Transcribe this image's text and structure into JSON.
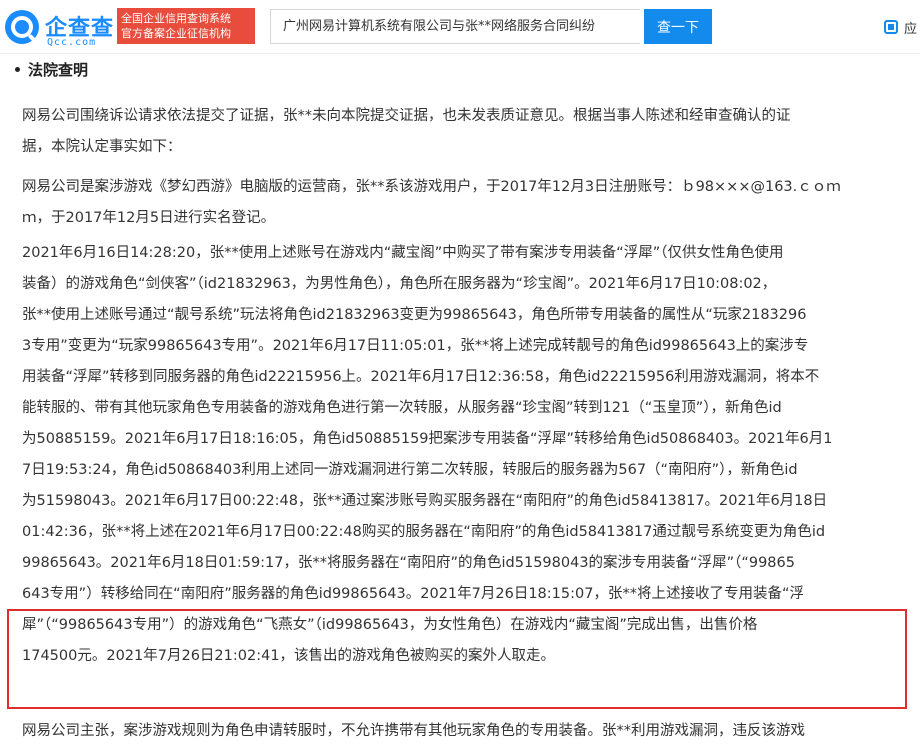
{
  "header": {
    "logo_name": "企查查",
    "logo_url": "Qcc.com",
    "slogan_line1": "全国企业信用查询系统",
    "slogan_line2": "官方备案企业征信机构",
    "search_value": "广州网易计算机系统有限公司与张**网络服务合同纠纷",
    "search_button": "查一下",
    "app_label": "应"
  },
  "section": {
    "title": "法院查明"
  },
  "paragraphs": [
    {
      "lines": [
        "网易公司围绕诉讼请求依法提交了证据，张**未向本院提交证据，也未发表质证意见。根据当事人陈述和经审查确认的证",
        "据，本院认定事实如下："
      ]
    },
    {
      "lines": [
        "网易公司是案涉游戏《梦幻西游》电脑版的运营商，张**系该游戏用户，于2017年12月3日注册账号：ｂ98×××@163.ｃｏｍ",
        "ｍ，于2017年12月5日进行实名登记。"
      ]
    },
    {
      "lines": [
        "2021年6月16日14:28:20，张**使用上述账号在游戏内“藏宝阁”中购买了带有案涉专用装备“浮犀”（仅供女性角色使用",
        "装备）的游戏角色“剑侠客”（id21832963，为男性角色），角色所在服务器为“珍宝阁”。2021年6月17日10:08:02，",
        "张**使用上述账号通过“靓号系统”玩法将角色id21832963变更为99865643，角色所带专用装备的属性从“玩家2183296",
        "3专用”变更为“玩家99865643专用”。2021年6月17日11:05:01，张**将上述完成转靓号的角色id99865643上的案涉专",
        "用装备“浮犀”转移到同服务器的角色id22215956上。2021年6月17日12:36:58，角色id22215956利用游戏漏洞，将本不",
        "能转服的、带有其他玩家角色专用装备的游戏角色进行第一次转服，从服务器“珍宝阁”转到121（“玉皇顶”），新角色id",
        "为50885159。2021年6月17日18:16:05，角色id50885159把案涉专用装备“浮犀”转移给角色id50868403。2021年6月1",
        "7日19:53:24，角色id50868403利用上述同一游戏漏洞进行第二次转服，转服后的服务器为567（“南阳府”），新角色id",
        "为51598043。2021年6月17日00:22:48，张**通过案涉账号购买服务器在“南阳府”的角色id58413817。2021年6月18日",
        "01:42:36，张**将上述在2021年6月17日00:22:48购买的服务器在“南阳府”的角色id58413817通过靓号系统变更为角色id",
        "99865643。2021年6月18日01:59:17，张**将服务器在“南阳府”的角色id51598043的案涉专用装备“浮犀”（“99865",
        "643专用”）转移给同在“南阳府”服务器的角色id99865643。2021年7月26日18:15:07，张**将上述接收了专用装备“浮",
        "犀”（“99865643专用”）的游戏角色“飞燕女”（id99865643，为女性角色）在游戏内“藏宝阁”完成出售，出售价格",
        "174500元。2021年7月26日21:02:41，该售出的游戏角色被购买的案外人取走。"
      ]
    },
    {
      "lines": [
        "网易公司主张，案涉游戏规则为角色申请转服时，不允许携带有其他玩家角色的专用装备。张**利用游戏漏洞，违反该游戏"
      ]
    }
  ]
}
